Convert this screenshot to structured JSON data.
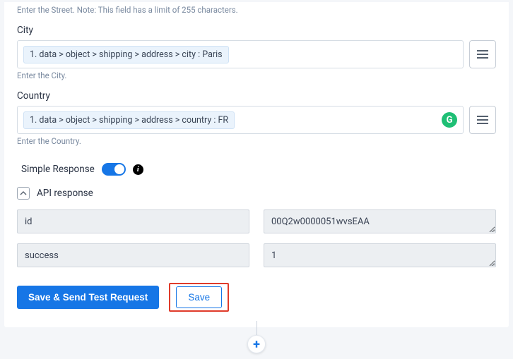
{
  "streetField": {
    "hint": "Enter the Street. Note: This field has a limit of 255 characters."
  },
  "cityField": {
    "label": "City",
    "chip": "1. data > object > shipping > address > city : Paris",
    "hint": "Enter the City."
  },
  "countryField": {
    "label": "Country",
    "chip": "1. data > object > shipping > address > country : FR",
    "hint": "Enter the Country.",
    "badge": "G"
  },
  "simpleResponse": {
    "label": "Simple Response",
    "enabled": true
  },
  "apiResponse": {
    "title": "API response",
    "rows": {
      "0": {
        "key": "id",
        "value": "00Q2w0000051wvsEAA"
      },
      "1": {
        "key": "success",
        "value": "1"
      }
    }
  },
  "buttons": {
    "saveSend": "Save & Send Test Request",
    "save": "Save"
  },
  "plus": "+"
}
